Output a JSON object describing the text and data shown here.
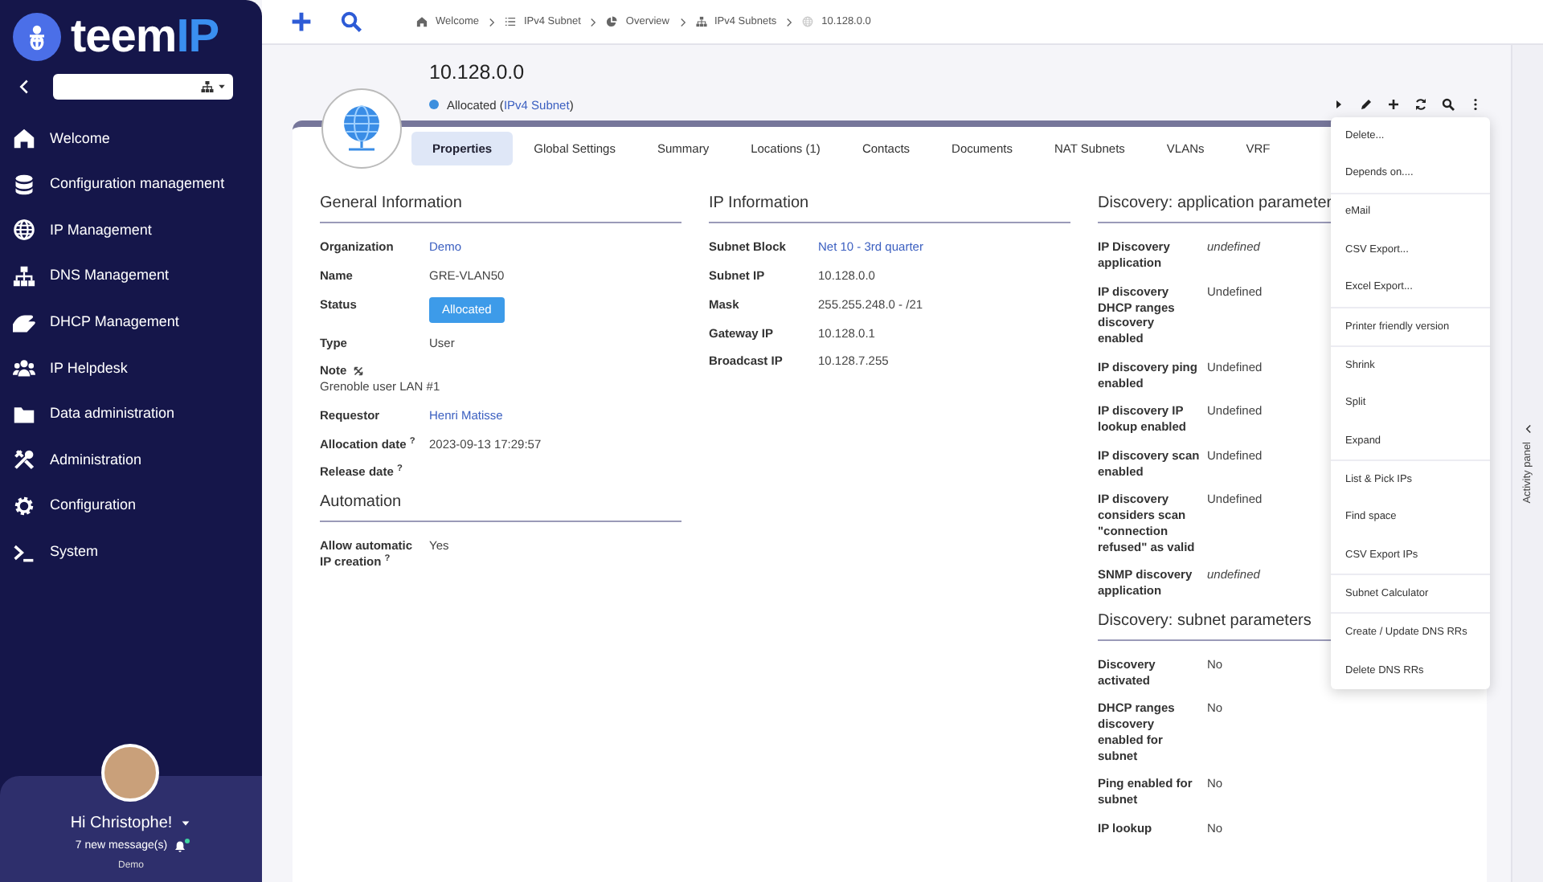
{
  "sidebar": {
    "logo": {
      "text": "teem",
      "accent": "IP"
    },
    "items": [
      {
        "label": "Welcome"
      },
      {
        "label": "Configuration management"
      },
      {
        "label": "IP Management"
      },
      {
        "label": "DNS Management"
      },
      {
        "label": "DHCP Management"
      },
      {
        "label": "IP Helpdesk"
      },
      {
        "label": "Data administration"
      },
      {
        "label": "Administration"
      },
      {
        "label": "Configuration"
      },
      {
        "label": "System"
      }
    ],
    "user": {
      "greeting": "Hi Christophe!",
      "messages": "7 new message(s)",
      "organization": "Demo"
    }
  },
  "breadcrumb": [
    "Welcome",
    "IPv4 Subnet",
    "Overview",
    "IPv4 Subnets",
    "10.128.0.0"
  ],
  "header": {
    "title": "10.128.0.0",
    "status": "Allocated",
    "class": {
      "before": "(",
      "link": "IPv4 Subnet",
      "after": ")"
    }
  },
  "tabs": [
    {
      "label": "Properties",
      "selected": true
    },
    {
      "label": "Global Settings",
      "selected": false
    },
    {
      "label": "Summary",
      "selected": false
    },
    {
      "label": "Locations (1)",
      "selected": false
    },
    {
      "label": "Contacts",
      "selected": false
    },
    {
      "label": "Documents",
      "selected": false
    },
    {
      "label": "NAT Subnets",
      "selected": false
    },
    {
      "label": "VLANs",
      "selected": false
    },
    {
      "label": "VRF",
      "selected": false
    }
  ],
  "columns": [
    [
      {
        "title": "General Information",
        "fields": [
          {
            "label": "Organization",
            "value": "Demo",
            "kind": "link"
          },
          {
            "label": "Name",
            "value": "GRE-VLAN50",
            "kind": "text"
          },
          {
            "label": "Status",
            "value": "Allocated",
            "kind": "badge"
          },
          {
            "label": "Type",
            "value": "User",
            "kind": "text"
          },
          {
            "label": "Note",
            "value": "Grenoble user LAN #1",
            "kind": "note"
          },
          {
            "label": "Requestor",
            "value": "Henri Matisse",
            "kind": "link"
          },
          {
            "label": "Allocation date $^{?}$",
            "value": "2023-09-13 17:29:57",
            "kind": "text"
          },
          {
            "label": "Release date $^{?}$",
            "kind": "text"
          }
        ]
      },
      {
        "title": "Automation",
        "fields": [
          {
            "label": "Allow automatic IP creation $^{?}$",
            "value": "Yes",
            "kind": "text"
          }
        ]
      }
    ],
    [
      {
        "title": "IP Information",
        "fields": [
          {
            "label": "Subnet Block",
            "value": "Net 10 - 3rd quarter",
            "kind": "link"
          },
          {
            "label": "Subnet IP",
            "value": "10.128.0.0",
            "kind": "text"
          },
          {
            "label": "Mask",
            "value": "255.255.248.0 - /21",
            "kind": "text"
          },
          {
            "label": "Gateway IP",
            "value": "10.128.0.1",
            "kind": "text"
          },
          {
            "label": "Broadcast IP",
            "value": "10.128.7.255",
            "kind": "text"
          }
        ]
      }
    ],
    [
      {
        "title": "Discovery: application parameter",
        "fields": [
          {
            "label": "IP Discovery application",
            "value": "undefined",
            "kind": "italic"
          },
          {
            "label": "IP discovery DHCP ranges discovery enabled",
            "value": "Undefined",
            "kind": "text"
          },
          {
            "label": "IP discovery ping enabled",
            "value": "Undefined",
            "kind": "text"
          },
          {
            "label": "IP discovery IP lookup enabled",
            "value": "Undefined",
            "kind": "text"
          },
          {
            "label": "IP discovery scan enabled",
            "value": "Undefined",
            "kind": "text"
          },
          {
            "label": "IP discovery considers scan \"connection refused\" as valid",
            "value": "Undefined",
            "kind": "text"
          },
          {
            "label": "SNMP discovery application",
            "value": "undefined",
            "kind": "italic"
          }
        ]
      },
      {
        "title": "Discovery: subnet parameters",
        "fields": [
          {
            "label": "Discovery activated",
            "value": "No",
            "kind": "text"
          },
          {
            "label": "DHCP ranges discovery enabled for subnet",
            "value": "No",
            "kind": "text"
          },
          {
            "label": "Ping enabled for subnet",
            "value": "No",
            "kind": "text"
          },
          {
            "label": "IP lookup",
            "value": "No",
            "kind": "text"
          }
        ]
      }
    ]
  ],
  "menu": [
    [
      "Delete...",
      "Depends on...."
    ],
    [
      "eMail",
      "CSV Export...",
      "Excel Export..."
    ],
    [
      "Printer friendly version"
    ],
    [
      "Shrink",
      "Split",
      "Expand"
    ],
    [
      "List & Pick IPs",
      "Find space",
      "CSV Export IPs"
    ],
    [
      "Subnet Calculator"
    ],
    [
      "Create / Update DNS RRs",
      "Delete DNS RRs"
    ]
  ],
  "activity_panel": {
    "label": "Activity panel"
  }
}
